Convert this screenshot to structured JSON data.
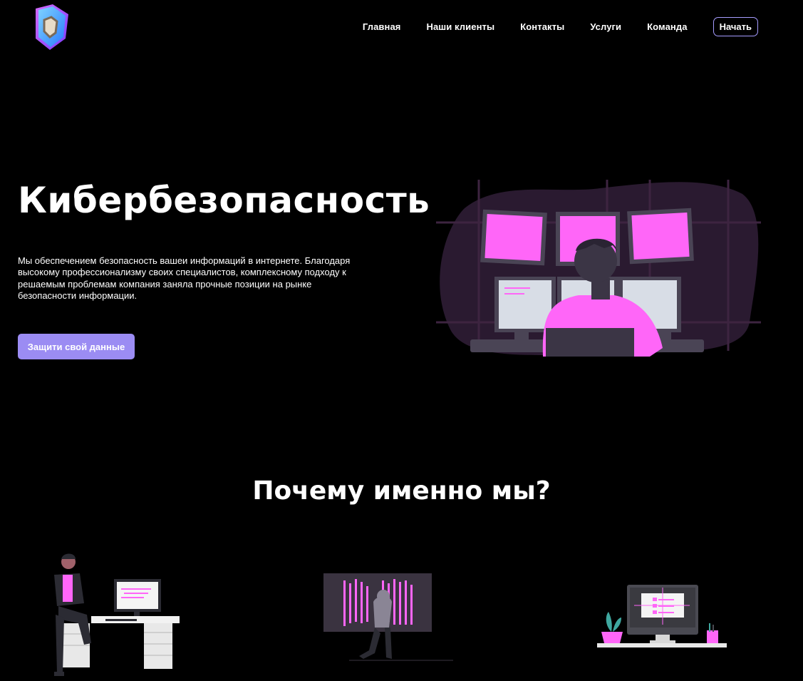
{
  "brand": {
    "logo_icon": "shield-logo-icon",
    "colors": {
      "accent": "#9b8cf3",
      "magenta": "#ff66f8",
      "background": "#000000"
    }
  },
  "nav": {
    "items": [
      {
        "label": "Главная"
      },
      {
        "label": "Наши клиенты"
      },
      {
        "label": "Контакты"
      },
      {
        "label": "Услуги"
      },
      {
        "label": "Команда"
      }
    ],
    "start_label": "Начать"
  },
  "hero": {
    "title": "Кибербезопасность",
    "text": "Мы обеспечением безопасность вашеи информаций в интернете. Благодаря высокому профессионализму своих специалистов, комплексному подходу к решаемым проблемам компания заняла прочные позиции на рынке безопасности информации.",
    "cta_label": "Защити свой данные",
    "illustration": "security-operator-monitors-illustration"
  },
  "why": {
    "title": "Почему именно мы?",
    "features": [
      {
        "illustration": "developer-at-desk-illustration"
      },
      {
        "illustration": "hacker-code-screen-illustration"
      },
      {
        "illustration": "monitor-dashboard-illustration"
      }
    ]
  }
}
